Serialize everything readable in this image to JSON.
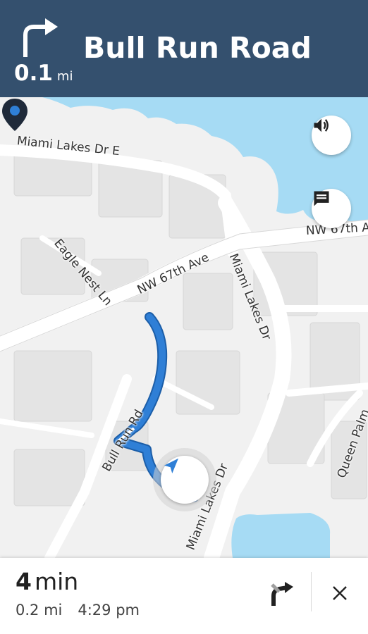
{
  "banner": {
    "distance_value": "0.1",
    "distance_unit": "mi",
    "street_name": "Bull Run Road",
    "turn_icon": "turn-right-icon",
    "background": "#34506e"
  },
  "map": {
    "labels": {
      "miami_lakes_dr_e": "Miami Lakes Dr E",
      "nw_67th_ave": "NW 67th Ave",
      "nw_67th_av_right": "NW 67th Av",
      "eagle_nest_ln": "Eagle Nest Ln",
      "miami_lakes_dr_1": "Miami Lakes Dr",
      "miami_lakes_dr_2": "Miami Lakes Dr",
      "bull_run_rd": "Bull Run Rd",
      "queen_palm": "Queen Palm"
    },
    "route_color": "#2f7fd6",
    "water_color": "#a6dbf4",
    "buttons": {
      "sound_icon": "volume-icon",
      "report_icon": "message-icon"
    }
  },
  "trip": {
    "eta_minutes": "4",
    "eta_unit": "min",
    "remaining_distance": "0.2 mi",
    "arrival_time": "4:29 pm",
    "route_options_icon": "route-fork-icon",
    "close_icon": "close-icon"
  }
}
